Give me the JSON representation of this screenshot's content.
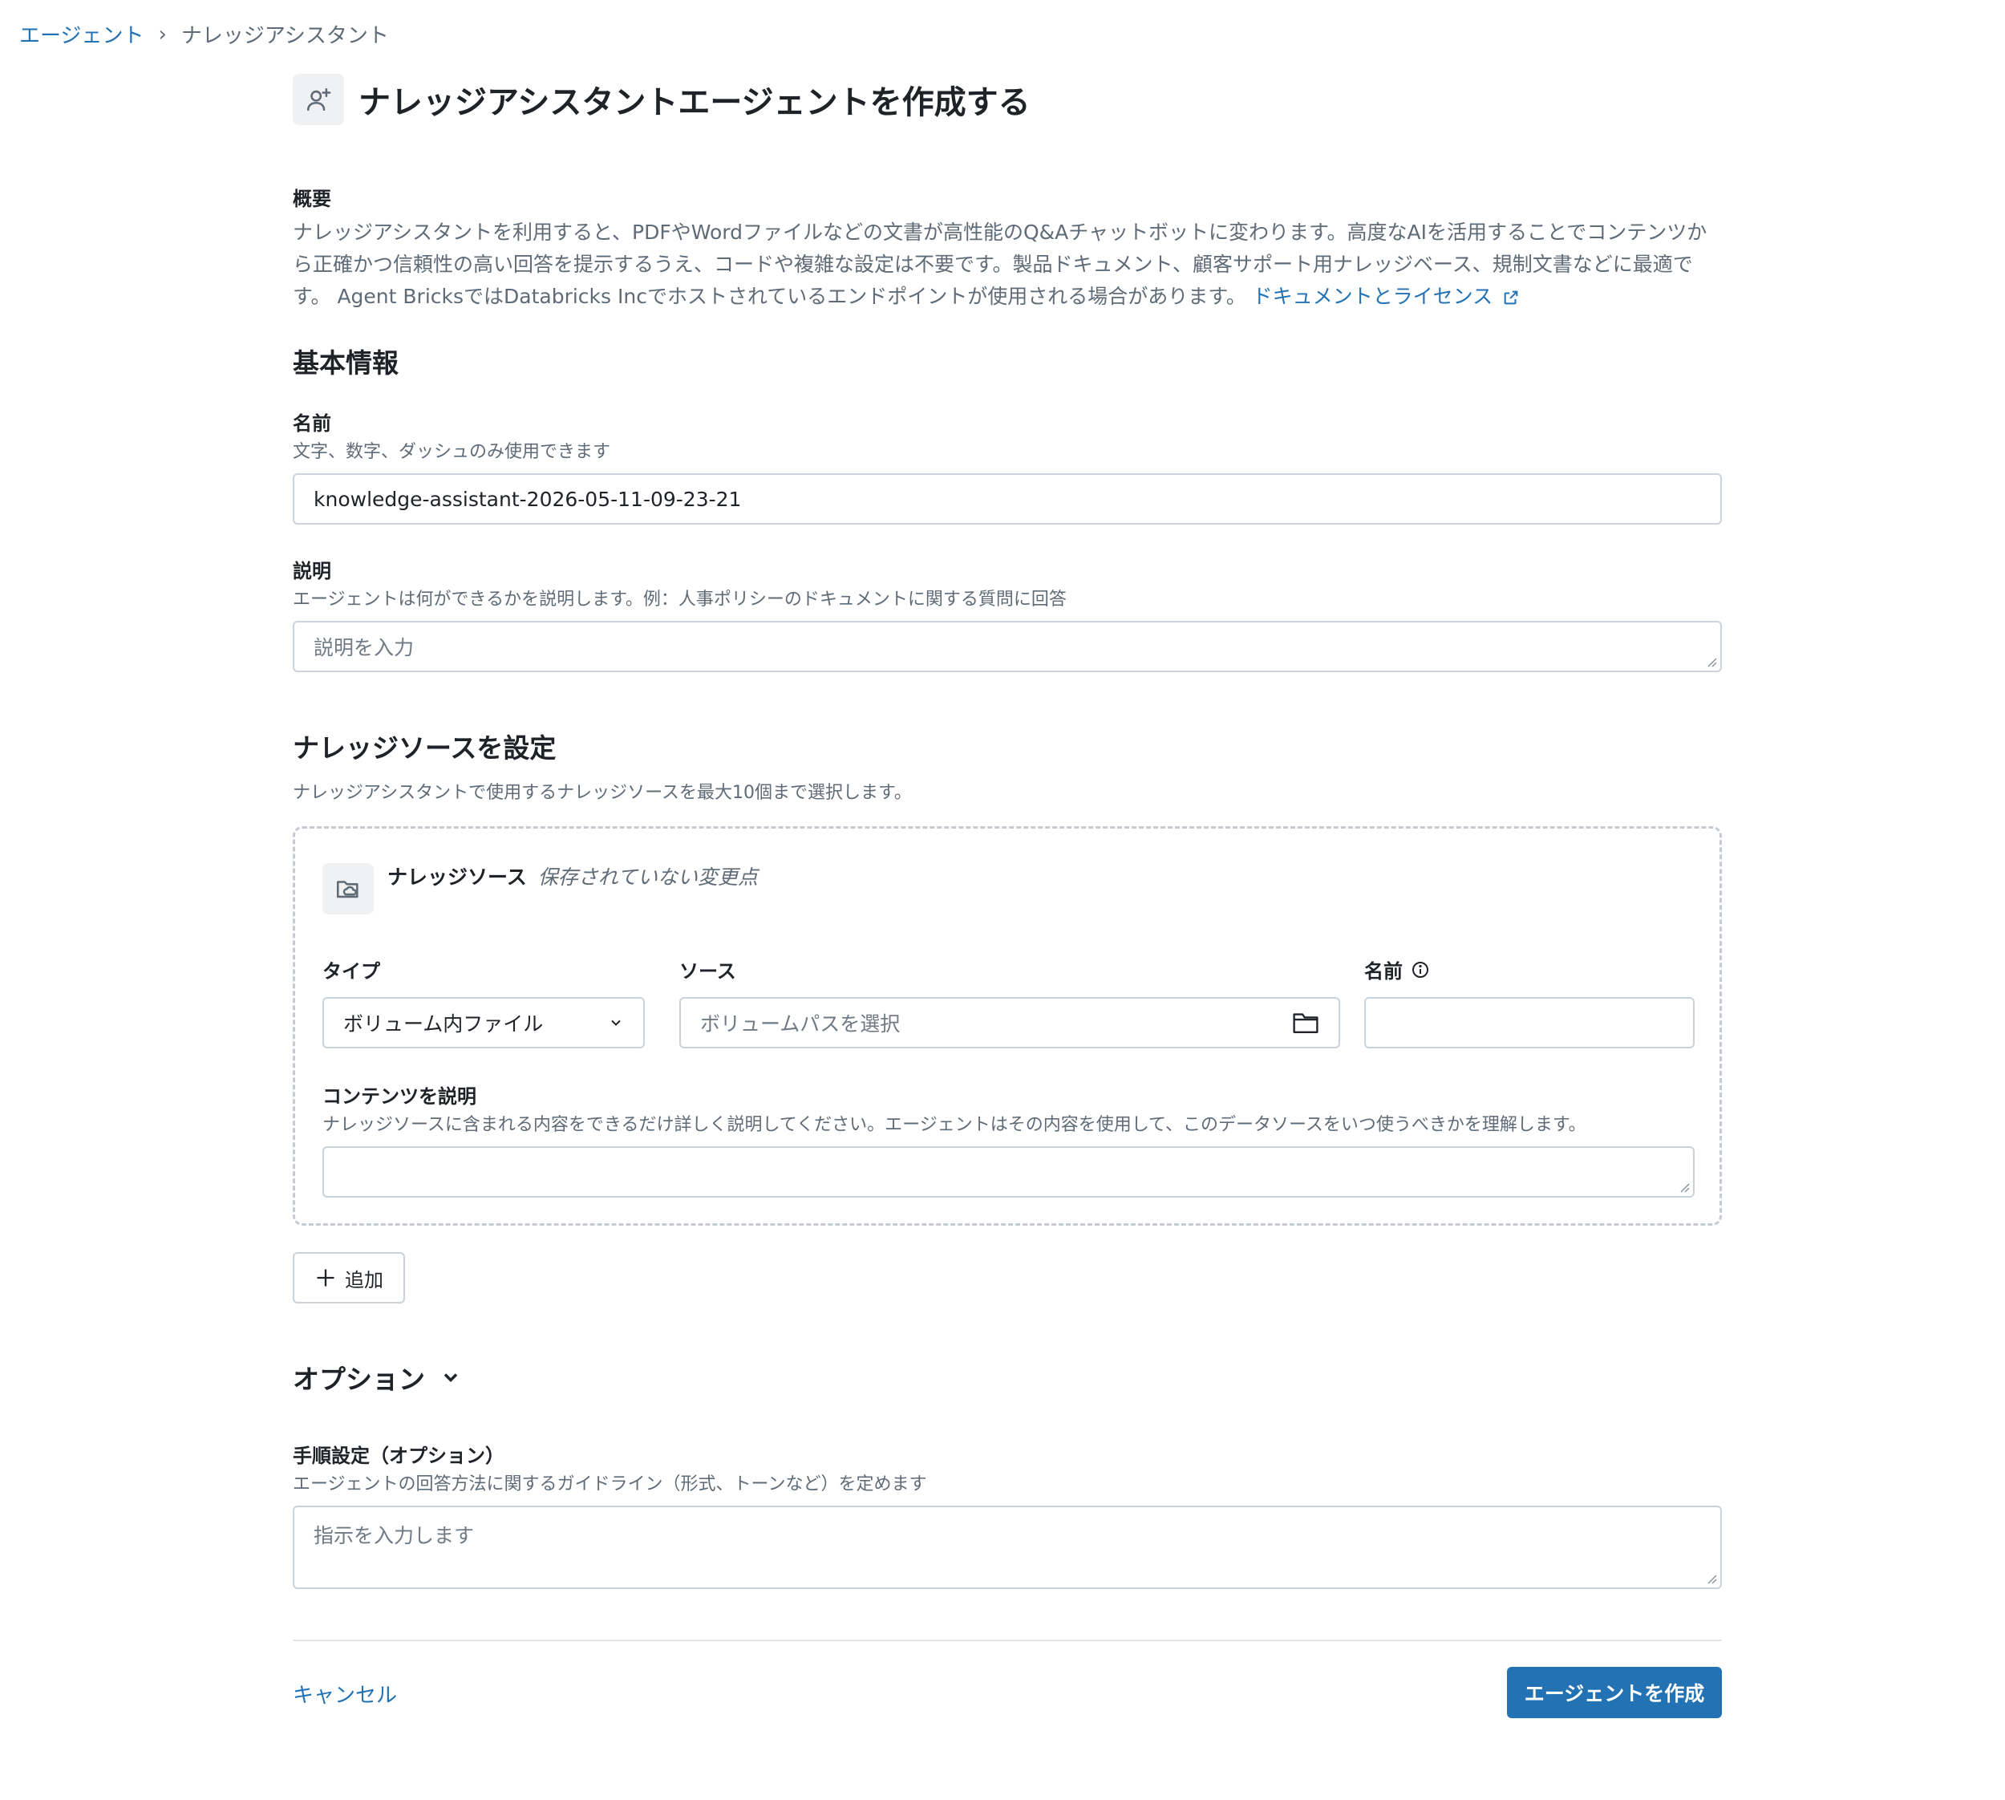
{
  "breadcrumb": {
    "parent": "エージェント",
    "separator": "›",
    "current": "ナレッジアシスタント"
  },
  "header": {
    "title": "ナレッジアシスタントエージェントを作成する",
    "icon": "user-plus-icon"
  },
  "overview": {
    "heading": "概要",
    "text": "ナレッジアシスタントを利用すると、PDFやWordファイルなどの文書が高性能のQ&Aチャットボットに変わります。高度なAIを活用することでコンテンツから正確かつ信頼性の高い回答を提示するうえ、コードや複雑な設定は不要です。製品ドキュメント、顧客サポート用ナレッジベース、規制文書などに最適です。 Agent BricksではDatabricks Incでホストされているエンドポイントが使用される場合があります。",
    "link_text": "ドキュメントとライセンス",
    "link_icon": "external-link-icon"
  },
  "basic_info": {
    "heading": "基本情報",
    "name_label": "名前",
    "name_hint": "文字、数字、ダッシュのみ使用できます",
    "name_value": "knowledge-assistant-2026-05-11-09-23-21",
    "desc_label": "説明",
    "desc_hint": "エージェントは何ができるかを説明します。例：人事ポリシーのドキュメントに関する質問に回答",
    "desc_placeholder": "説明を入力"
  },
  "knowledge": {
    "heading": "ナレッジソースを設定",
    "hint": "ナレッジアシスタントで使用するナレッジソースを最大10個まで選択します。",
    "card_title": "ナレッジソース",
    "card_status": "保存されていない変更点",
    "type_label": "タイプ",
    "type_value": "ボリューム内ファイル",
    "source_label": "ソース",
    "source_placeholder": "ボリュームパスを選択",
    "name_label": "名前",
    "content_label": "コンテンツを説明",
    "content_hint": "ナレッジソースに含まれる内容をできるだけ詳しく説明してください。エージェントはその内容を使用して、このデータソースをいつ使うべきかを理解します。",
    "add_label": "追加"
  },
  "options": {
    "heading": "オプション",
    "instructions_label": "手順設定（オプション）",
    "instructions_hint": "エージェントの回答方法に関するガイドライン（形式、トーンなど）を定めます",
    "instructions_placeholder": "指示を入力します"
  },
  "footer": {
    "cancel_label": "キャンセル",
    "create_label": "エージェントを作成"
  }
}
